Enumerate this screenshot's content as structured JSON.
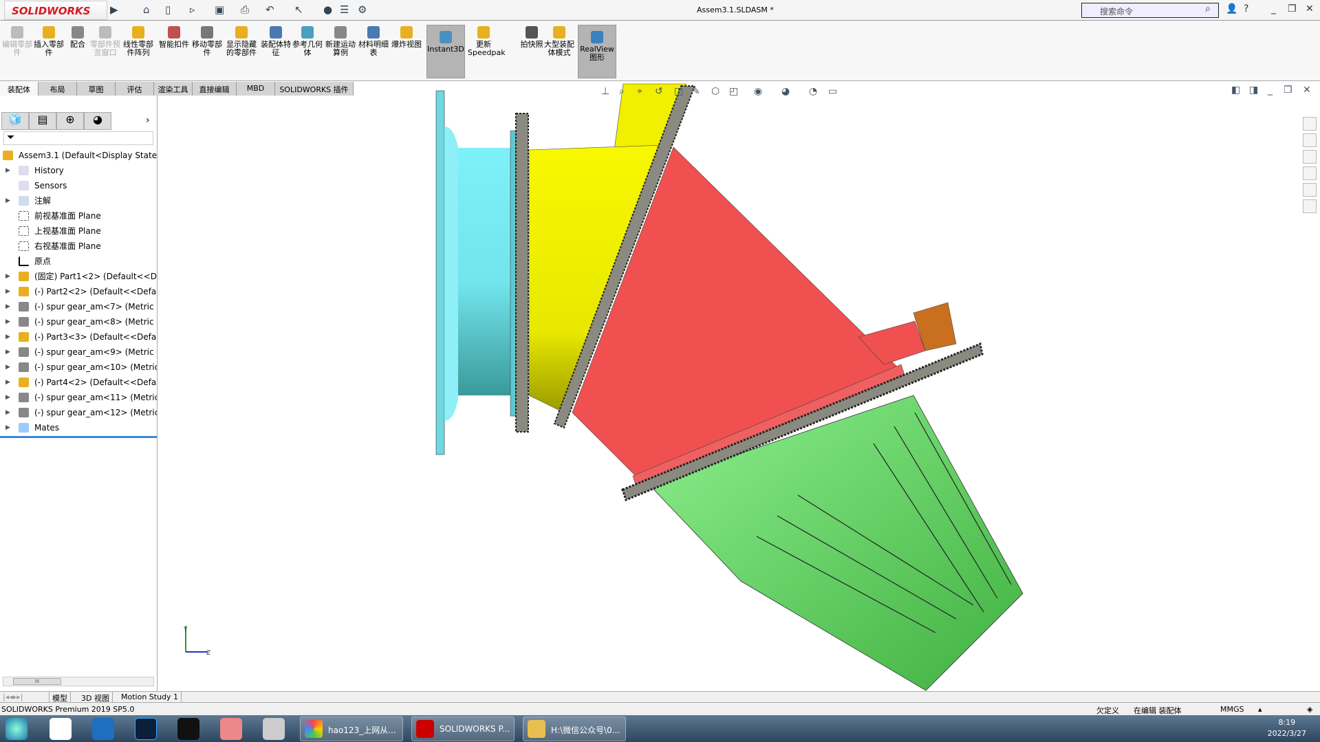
{
  "app": {
    "logo": "SOLIDWORKS",
    "document_title": "Assem3.1.SLDASM *",
    "search_placeholder": "搜索命令"
  },
  "quick_access": [
    "home-icon",
    "new-icon",
    "open-icon",
    "save-icon",
    "print-icon",
    "undo-icon",
    "select-icon",
    "rebuild-icon",
    "file-properties-icon",
    "options-icon"
  ],
  "ribbon": [
    {
      "label": "编辑零部件",
      "disabled": true,
      "color": "#bbbbbb"
    },
    {
      "label": "插入零部件",
      "color": "#e8b020"
    },
    {
      "label": "配合",
      "color": "#888888"
    },
    {
      "label": "零部件预览窗口",
      "disabled": true,
      "color": "#bbbbbb"
    },
    {
      "label": "线性零部件阵列",
      "color": "#e8b020"
    },
    {
      "label": "智能扣件",
      "color": "#c0504d"
    },
    {
      "label": "移动零部件",
      "color": "#777777"
    },
    {
      "label": "显示隐藏的零部件",
      "color": "#e8b020"
    },
    {
      "label": "装配体特征",
      "color": "#4a7ab0"
    },
    {
      "label": "参考几何体",
      "color": "#4aa0c0"
    },
    {
      "label": "新建运动算例",
      "color": "#888888"
    },
    {
      "label": "材料明细表",
      "color": "#4a7ab0"
    },
    {
      "label": "爆炸视图",
      "color": "#e8b020"
    },
    {
      "label": "Instant3D",
      "active": true,
      "color": "#4a90c0"
    },
    {
      "label": "更新Speedpak",
      "color": "#e8b020"
    },
    {
      "label": "拍快照",
      "color": "#555555"
    },
    {
      "label": "大型装配体模式",
      "color": "#e8b020"
    },
    {
      "label": "RealView图形",
      "active": true,
      "color": "#3a80c0"
    }
  ],
  "tabs": [
    "装配体",
    "布局",
    "草图",
    "评估",
    "渲染工具",
    "直接编辑",
    "MBD",
    "SOLIDWORKS 插件"
  ],
  "tree": {
    "root": "Assem3.1  (Default<Display State-1",
    "items": [
      {
        "label": "History",
        "icon": "history-folder-icon",
        "arrow": true
      },
      {
        "label": "Sensors",
        "icon": "sensors-folder-icon",
        "arrow": false
      },
      {
        "label": "注解",
        "icon": "annotations-icon",
        "arrow": true
      },
      {
        "label": "前视基准面 Plane",
        "icon": "plane-icon",
        "arrow": false
      },
      {
        "label": "上视基准面 Plane",
        "icon": "plane-icon",
        "arrow": false
      },
      {
        "label": "右视基准面 Plane",
        "icon": "plane-icon",
        "arrow": false
      },
      {
        "label": "原点",
        "icon": "origin-icon",
        "arrow": false
      },
      {
        "label": "(固定) Part1<2> (Default<<Def",
        "icon": "part-icon",
        "arrow": true
      },
      {
        "label": "(-) Part2<2> (Default<<Default",
        "icon": "part-icon",
        "arrow": true
      },
      {
        "label": "(-) spur gear_am<7> (Metric -",
        "icon": "toolbox-part-icon",
        "arrow": true
      },
      {
        "label": "(-) spur gear_am<8> (Metric -",
        "icon": "toolbox-part-icon",
        "arrow": true
      },
      {
        "label": "(-) Part3<3> (Default<<Default",
        "icon": "part-icon",
        "arrow": true
      },
      {
        "label": "(-) spur gear_am<9> (Metric -",
        "icon": "toolbox-part-icon",
        "arrow": true
      },
      {
        "label": "(-) spur gear_am<10> (Metric",
        "icon": "toolbox-part-icon",
        "arrow": true
      },
      {
        "label": "(-) Part4<2> (Default<<Default",
        "icon": "part-icon",
        "arrow": true
      },
      {
        "label": "(-) spur gear_am<11> (Metric",
        "icon": "toolbox-part-icon",
        "arrow": true
      },
      {
        "label": "(-) spur gear_am<12> (Metric",
        "icon": "toolbox-part-icon",
        "arrow": true
      },
      {
        "label": "Mates",
        "icon": "mates-icon",
        "arrow": true
      }
    ]
  },
  "scroll_thumb": "III",
  "bottom_tabs": [
    "模型",
    "3D 视图",
    "Motion Study 1"
  ],
  "status": {
    "product": "SOLIDWORKS Premium 2019 SP5.0",
    "state": "欠定义",
    "mode": "在编辑 装配体",
    "units": "MMGS"
  },
  "taskbar": {
    "apps": [
      "hao123_上网从...",
      "SOLIDWORKS P...",
      "H:\\微信公众号\\0..."
    ],
    "time": "8:19",
    "date": "2022/3/27"
  },
  "colors": {
    "cyan_part": "#6fe6f0",
    "yellow_part": "#f0f000",
    "red_part": "#f05050",
    "green_part": "#70e070",
    "gear": "#8a8a80",
    "accent": "#d71920"
  }
}
